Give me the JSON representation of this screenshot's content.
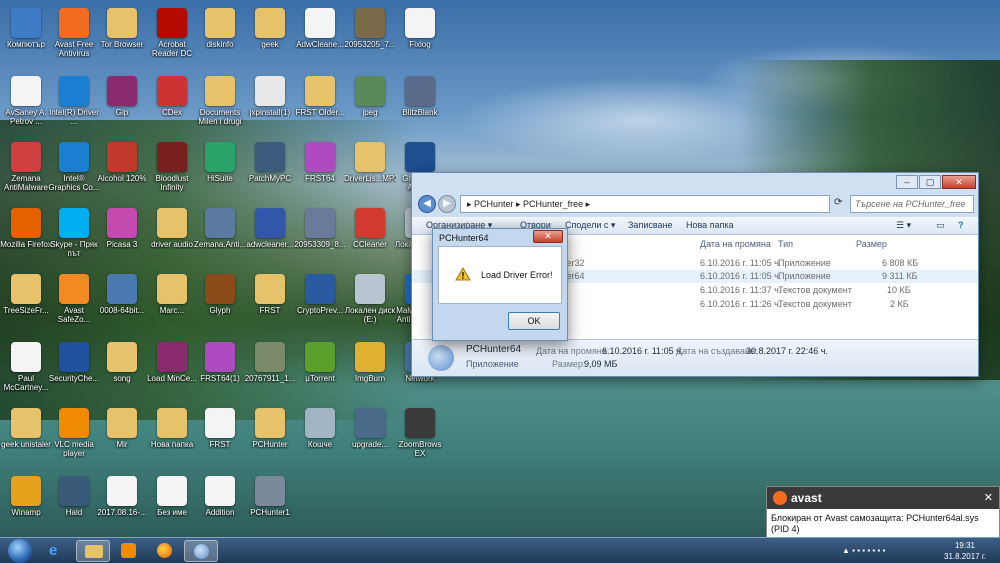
{
  "desktop_icons": [
    {
      "label": "Компютър",
      "icon": "computer-icon",
      "color": "#3f7cc7"
    },
    {
      "label": "Avast Free Antivirus",
      "icon": "avast-icon",
      "color": "#f26b21"
    },
    {
      "label": "Tor Browser",
      "icon": "folder-icon",
      "color": "#e6c36a"
    },
    {
      "label": "Acrobat Reader DC",
      "icon": "acrobat-icon",
      "color": "#b30b00"
    },
    {
      "label": "diskinfo",
      "icon": "folder-icon",
      "color": "#e6c36a"
    },
    {
      "label": "geek",
      "icon": "folder-icon",
      "color": "#e6c36a"
    },
    {
      "label": "AdwCleane...",
      "icon": "document-icon",
      "color": "#f4f4f4"
    },
    {
      "label": "20953205_7...",
      "icon": "image-icon",
      "color": "#7a6a4a"
    },
    {
      "label": "Fixlog",
      "icon": "document-icon",
      "color": "#f4f4f4"
    },
    {
      "label": "AvSaney A. Petrov ...",
      "icon": "document-icon",
      "color": "#f4f4f4"
    },
    {
      "label": "Intel(R) Driver ...",
      "icon": "intel-icon",
      "color": "#1a7fd0"
    },
    {
      "label": "Gip",
      "icon": "winrar-icon",
      "color": "#8a2b6f"
    },
    {
      "label": "CDex",
      "icon": "cdex-icon",
      "color": "#c33"
    },
    {
      "label": "Documents Milen i drugi",
      "icon": "folder-icon",
      "color": "#e6c36a"
    },
    {
      "label": "jxpinstall(1)",
      "icon": "java-icon",
      "color": "#e8e8e8"
    },
    {
      "label": "FRST Older...",
      "icon": "folder-icon",
      "color": "#e6c36a"
    },
    {
      "label": "jpeg",
      "icon": "image-icon",
      "color": "#5a8a5a"
    },
    {
      "label": "BlitzBlank",
      "icon": "blitzblank-icon",
      "color": "#5a6a8a"
    },
    {
      "label": "Zemana AntiMalware",
      "icon": "zemana-icon",
      "color": "#d04040"
    },
    {
      "label": "Intel® Graphics Co...",
      "icon": "intel-graphics-icon",
      "color": "#1a7fd0"
    },
    {
      "label": "Alcohol 120%",
      "icon": "alcohol-icon",
      "color": "#c0392b"
    },
    {
      "label": "Bloodlust Infinity",
      "icon": "game-icon",
      "color": "#7a1f1f"
    },
    {
      "label": "HiSuite",
      "icon": "hisuite-icon",
      "color": "#2aa36b"
    },
    {
      "label": "PatchMyPC",
      "icon": "patchmypc-icon",
      "color": "#3b5b7a"
    },
    {
      "label": "FRST64",
      "icon": "frst-icon",
      "color": "#b04ac0"
    },
    {
      "label": "DriverLis...MP3",
      "icon": "folder-icon",
      "color": "#e6c36a"
    },
    {
      "label": "GameSpy Arcade",
      "icon": "gamespy-icon",
      "color": "#1f4f8f"
    },
    {
      "label": "Mozilla Firefox",
      "icon": "firefox-icon",
      "color": "#e66000"
    },
    {
      "label": "Skype - Пряк път",
      "icon": "skype-icon",
      "color": "#00aff0"
    },
    {
      "label": "Picasa 3",
      "icon": "picasa-icon",
      "color": "#c44ab0"
    },
    {
      "label": "driver audio",
      "icon": "folder-icon",
      "color": "#e6c36a"
    },
    {
      "label": "Zemana.Anti...",
      "icon": "installer-icon",
      "color": "#5a7aa0"
    },
    {
      "label": "adwcleaner...",
      "icon": "adwcleaner-icon",
      "color": "#3355aa"
    },
    {
      "label": "20953309_8...",
      "icon": "image-icon",
      "color": "#6a7a9a"
    },
    {
      "label": "CCleaner",
      "icon": "ccleaner-icon",
      "color": "#d13a2f"
    },
    {
      "label": "Локален диск (D:)",
      "icon": "drive-icon",
      "color": "#b8c4cf"
    },
    {
      "label": "TreeSizeFr...",
      "icon": "folder-icon",
      "color": "#e6c36a"
    },
    {
      "label": "Avast SafeZo...",
      "icon": "safezone-icon",
      "color": "#f28a21"
    },
    {
      "label": "0008-64bit...",
      "icon": "setup-icon",
      "color": "#4a7ab0"
    },
    {
      "label": "Marc...",
      "icon": "folder-icon",
      "color": "#e6c36a"
    },
    {
      "label": "Glyph",
      "icon": "glyph-icon",
      "color": "#8a4a1a"
    },
    {
      "label": "FRST",
      "icon": "folder-icon",
      "color": "#e6c36a"
    },
    {
      "label": "CryptoPrev...",
      "icon": "shield-icon",
      "color": "#2a5aa0"
    },
    {
      "label": "Локален диск (E:)",
      "icon": "drive-icon",
      "color": "#b8c4cf"
    },
    {
      "label": "Malwarebyt... Anti-Malware",
      "icon": "malwarebytes-icon",
      "color": "#1f6ed0"
    },
    {
      "label": "Paul McCartney...",
      "icon": "document-icon",
      "color": "#f4f4f4"
    },
    {
      "label": "SecurityChe...",
      "icon": "securitycheck-icon",
      "color": "#2050a0"
    },
    {
      "label": "song",
      "icon": "folder-icon",
      "color": "#e6c36a"
    },
    {
      "label": "Load MinCe...",
      "icon": "winrar-icon",
      "color": "#8a2b6f"
    },
    {
      "label": "FRST64(1)",
      "icon": "frst-icon",
      "color": "#b04ac0"
    },
    {
      "label": "20767911_1...",
      "icon": "image-icon",
      "color": "#7a8a6a"
    },
    {
      "label": "µTorrent",
      "icon": "utorrent-icon",
      "color": "#5aa02a"
    },
    {
      "label": "ImgBurn",
      "icon": "imgburn-icon",
      "color": "#e0b030"
    },
    {
      "label": "Network",
      "icon": "network-icon",
      "color": "#4a7ab0"
    },
    {
      "label": "geek unistaler",
      "icon": "folder-icon",
      "color": "#e6c36a"
    },
    {
      "label": "VLC media player",
      "icon": "vlc-icon",
      "color": "#f08a00"
    },
    {
      "label": "Mir",
      "icon": "folder-icon",
      "color": "#e6c36a"
    },
    {
      "label": "Нова папка",
      "icon": "folder-icon",
      "color": "#e6c36a"
    },
    {
      "label": "FRST",
      "icon": "document-icon",
      "color": "#f4f4f4"
    },
    {
      "label": "PCHunter",
      "icon": "folder-icon",
      "color": "#e6c36a"
    },
    {
      "label": "Кошче",
      "icon": "recycle-bin-icon",
      "color": "#a0b4c4"
    },
    {
      "label": "upgrade...",
      "icon": "upgrade-icon",
      "color": "#4a6a8a"
    },
    {
      "label": "ZoomBrows EX",
      "icon": "camera-icon",
      "color": "#3a3a3a"
    },
    {
      "label": "Winamp",
      "icon": "winamp-icon",
      "color": "#e6a21a"
    },
    {
      "label": "Hald",
      "icon": "hald-icon",
      "color": "#3a5a7a"
    },
    {
      "label": "2017.08.16-...",
      "icon": "document-icon",
      "color": "#f4f4f4"
    },
    {
      "label": "Без име",
      "icon": "document-icon",
      "color": "#f4f4f4"
    },
    {
      "label": "Addition",
      "icon": "document-icon",
      "color": "#f4f4f4"
    },
    {
      "label": "PCHunter1",
      "icon": "pchunter-icon",
      "color": "#7a8a9a"
    }
  ],
  "explorer": {
    "address": "▸ PCHunter ▸ PCHunter_free ▸",
    "search_placeholder": "Търсене на PCHunter_free",
    "toolbar": [
      "Организиране ▾",
      "Отвори",
      "Сподели с ▾",
      "Записване",
      "Нова папка"
    ],
    "columns": [
      "Дата на промяна",
      "Тип",
      "Размер"
    ],
    "rows": [
      {
        "name": "ter32",
        "date": "6.10.2016 г. 11:05 ч.",
        "type": "Приложение",
        "size": "6 808 КБ"
      },
      {
        "name": "ter64",
        "date": "6.10.2016 г. 11:05 ч.",
        "type": "Приложение",
        "size": "9 311 КБ"
      },
      {
        "name": "",
        "date": "6.10.2016 г. 11:37 ч.",
        "type": "Текстов документ",
        "size": "10 КБ"
      },
      {
        "name": "",
        "date": "6.10.2016 г. 11:26 ч.",
        "type": "Текстов документ",
        "size": "2 КБ"
      }
    ],
    "details": {
      "name": "PCHunter64",
      "type": "Приложение",
      "modified_label": "Дата на промяна:",
      "modified": "6.10.2016 г. 11:05 ч.",
      "created_label": "Дата на създаване:",
      "created": "30.8.2017 г. 22:46 ч.",
      "size_label": "Размер:",
      "size": "9,09 МБ"
    },
    "controls": [
      "‒",
      "▢",
      "✕"
    ]
  },
  "dialog": {
    "title": "PCHunter64",
    "close": "✕",
    "message": "Load Driver Error!",
    "ok": "OK"
  },
  "avast": {
    "brand": "avast",
    "close": "✕",
    "message": "Блокиран от Avast самозащита: PCHunter64al.sys (PID 4)",
    "accent": "#f26b21"
  },
  "taskbar": {
    "time": "19:31",
    "date": "31.8.2017 г.",
    "buttons": [
      "start-orb-icon",
      "ie-icon",
      "explorer-icon",
      "media-player-icon",
      "firefox-icon",
      "pchunter-icon"
    ]
  }
}
